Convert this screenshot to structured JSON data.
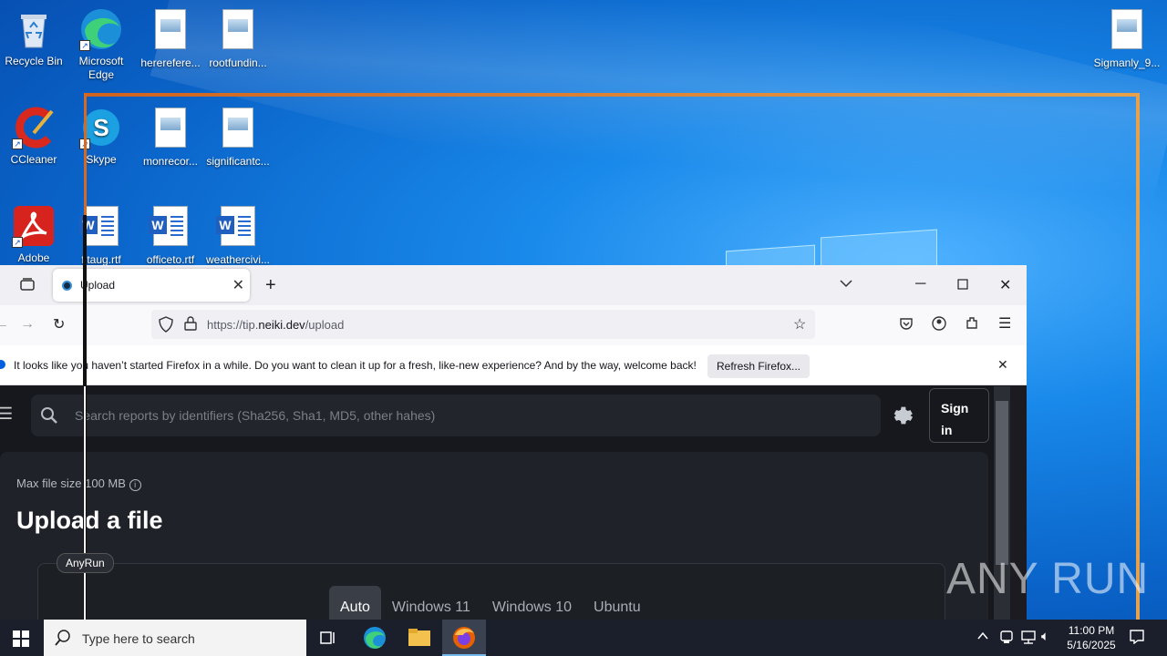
{
  "desktop": {
    "icons": [
      {
        "label": "Recycle Bin"
      },
      {
        "label": "Microsoft Edge"
      },
      {
        "label": "hererefere..."
      },
      {
        "label": "rootfundin..."
      },
      {
        "label": "Sigmanly_9..."
      },
      {
        "label": "CCleaner"
      },
      {
        "label": "Skype"
      },
      {
        "label": "monrecor..."
      },
      {
        "label": "significantc..."
      },
      {
        "label": "Adobe"
      },
      {
        "label": "fitaug.rtf"
      },
      {
        "label": "officeto.rtf"
      },
      {
        "label": "weathercivi..."
      }
    ]
  },
  "browser": {
    "tab_title": "Upload",
    "url_prefix": "https://tip.",
    "url_domain": "neiki.dev",
    "url_path": "/upload",
    "notification": "It looks like you haven’t started Firefox in a while. Do you want to clean it up for a fresh, like-new experience? And by the way, welcome back!",
    "refresh_label": "Refresh Firefox..."
  },
  "page": {
    "search_placeholder": "Search reports by identifiers (Sha256, Sha1, MD5, other hahes)",
    "signin_line1": "Sign",
    "signin_line2": "in",
    "max_size": "Max file size 100 MB",
    "title": "Upload a file",
    "os_tabs": [
      "Auto",
      "Windows 11",
      "Windows 10",
      "Ubuntu"
    ],
    "tag": "AnyRun"
  },
  "watermark": "ANY RUN",
  "taskbar": {
    "search_placeholder": "Type here to search",
    "time": "11:00 PM",
    "date": "5/16/2025"
  }
}
